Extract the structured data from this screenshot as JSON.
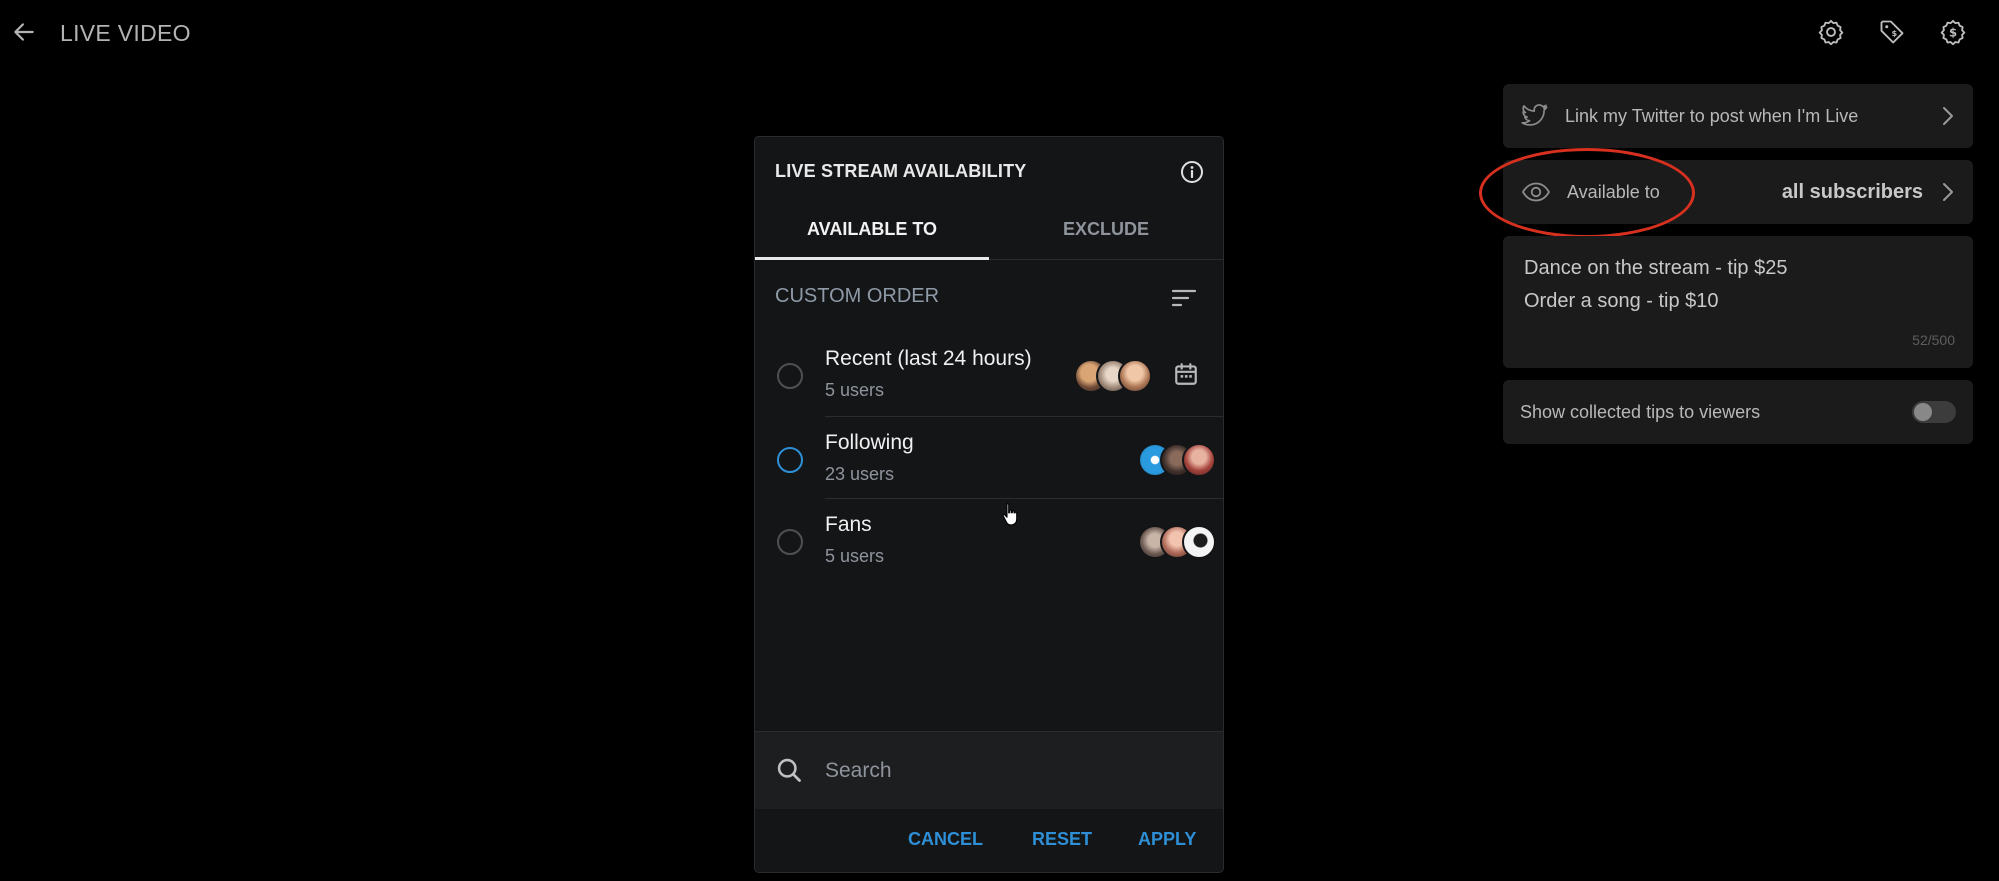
{
  "header": {
    "title": "LIVE VIDEO",
    "icons": [
      "back-arrow-icon",
      "gear-icon",
      "tag-icon",
      "dollar-gear-icon"
    ]
  },
  "right_panel": {
    "twitter": {
      "label": "Link my Twitter to post when I'm Live",
      "icon": "twitter-icon"
    },
    "availability": {
      "label": "Available to",
      "value": "all subscribers",
      "icon": "eye-icon"
    },
    "tips_menu": {
      "lines": [
        "Dance on the stream - tip $25",
        "Order a song - tip $10"
      ],
      "char_count": "52/500"
    },
    "collected_tips": {
      "label": "Show collected tips to viewers",
      "enabled": false
    }
  },
  "dialog": {
    "title": "LIVE STREAM AVAILABILITY",
    "tabs": [
      {
        "label": "AVAILABLE TO",
        "active": true
      },
      {
        "label": "EXCLUDE",
        "active": false
      }
    ],
    "section_title": "CUSTOM ORDER",
    "lists": [
      {
        "name": "Recent (last 24 hours)",
        "count": "5 users",
        "selected": false
      },
      {
        "name": "Following",
        "count": "23 users",
        "selected": false
      },
      {
        "name": "Fans",
        "count": "5 users",
        "selected": false
      }
    ],
    "search": {
      "placeholder": "Search",
      "value": ""
    },
    "actions": {
      "cancel": "CANCEL",
      "reset": "RESET",
      "apply": "APPLY"
    }
  },
  "colors": {
    "background": "#000000",
    "panel": "#1b1b1b",
    "dialog": "#141517",
    "accent": "#2e8fd6",
    "highlight": "#d8301f"
  }
}
